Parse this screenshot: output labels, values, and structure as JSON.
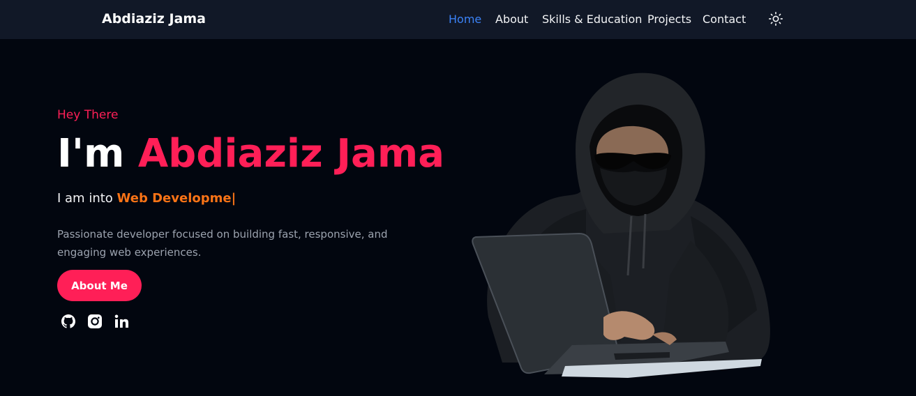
{
  "navbar": {
    "brand": "Abdiaziz Jama",
    "links": [
      {
        "label": "Home",
        "active": true
      },
      {
        "label": "About",
        "active": false
      },
      {
        "label": "Skills & Education",
        "active": false
      },
      {
        "label": "Projects",
        "active": false
      },
      {
        "label": "Contact",
        "active": false
      }
    ],
    "theme_toggle_icon": "sun-icon"
  },
  "hero": {
    "greeting": "Hey There",
    "title_prefix": "I'm",
    "title_name": "Abdiaziz Jama",
    "subtitle_prefix": "I am into",
    "typed_text": "Web Developme",
    "typed_cursor": "|",
    "description": "Passionate developer focused on building fast, responsive, and engaging web experiences.",
    "cta_label": "About Me",
    "socials": [
      {
        "name": "github",
        "icon": "github-icon"
      },
      {
        "name": "instagram",
        "icon": "instagram-icon"
      },
      {
        "name": "linkedin",
        "icon": "linkedin-icon"
      }
    ],
    "illustration": "hooded-hacker-laptop"
  },
  "colors": {
    "background": "#02060f",
    "navbar": "#111827",
    "accent": "#ff1f57",
    "active_link": "#3b82f6",
    "typed": "#f97316",
    "muted": "#9ca3af"
  }
}
